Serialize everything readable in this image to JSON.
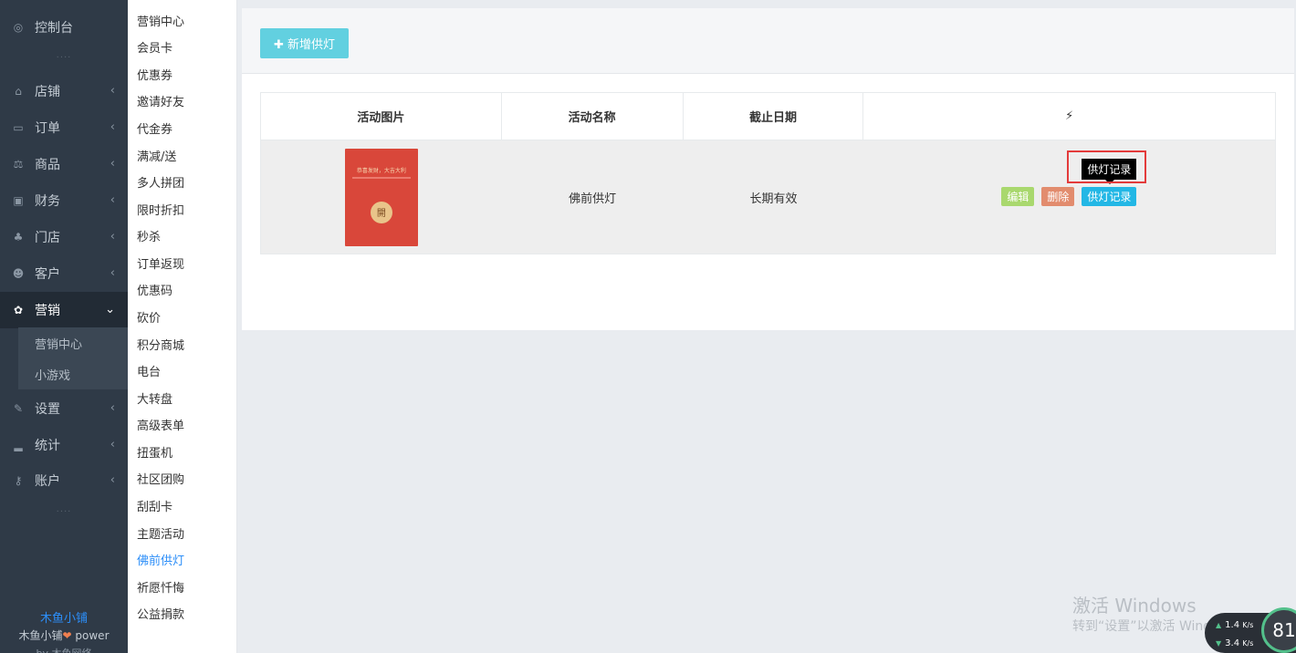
{
  "sidebar": {
    "items": [
      {
        "label": "控制台",
        "icon": "dashboard-icon",
        "chevron": ""
      },
      {
        "label": "店铺",
        "icon": "shop-icon",
        "chevron": "‹"
      },
      {
        "label": "订单",
        "icon": "order-icon",
        "chevron": "‹"
      },
      {
        "label": "商品",
        "icon": "scale-icon",
        "chevron": "‹"
      },
      {
        "label": "财务",
        "icon": "money-icon",
        "chevron": "‹"
      },
      {
        "label": "门店",
        "icon": "store-tree-icon",
        "chevron": "‹"
      },
      {
        "label": "客户",
        "icon": "users-icon",
        "chevron": "‹"
      },
      {
        "label": "营销",
        "icon": "gift-icon",
        "chevron": "⌄"
      },
      {
        "label": "设置",
        "icon": "wrench-icon",
        "chevron": "‹"
      },
      {
        "label": "统计",
        "icon": "signal-icon",
        "chevron": "‹"
      },
      {
        "label": "账户",
        "icon": "key-icon",
        "chevron": "‹"
      }
    ],
    "subitems": [
      "营销中心",
      "小游戏"
    ],
    "dots": "····",
    "brand_name": "木鱼小铺",
    "brand_power": "木鱼小铺",
    "brand_power_suffix": "power",
    "brand_extra": "by 木鱼网络"
  },
  "submenu": {
    "items": [
      "营销中心",
      "会员卡",
      "优惠券",
      "邀请好友",
      "代金券",
      "满减/送",
      "多人拼团",
      "限时折扣",
      "秒杀",
      "订单返现",
      "优惠码",
      "砍价",
      "积分商城",
      "电台",
      "大转盘",
      "高级表单",
      "扭蛋机",
      "社区团购",
      "刮刮卡",
      "主题活动",
      "佛前供灯",
      "祈愿忏悔",
      "公益捐款"
    ],
    "current": "佛前供灯"
  },
  "toolbar": {
    "add_label": "✚ 新增供灯"
  },
  "table": {
    "headers": [
      "活动图片",
      "活动名称",
      "截止日期",
      "⚡"
    ],
    "rows": [
      {
        "thumb_title": "恭喜发财，大吉大利",
        "thumb_coin": "開",
        "name": "佛前供灯",
        "deadline": "长期有效"
      }
    ]
  },
  "actions": {
    "edit": "编辑",
    "delete": "删除",
    "records": "供灯记录",
    "tooltip": "供灯记录"
  },
  "watermark": {
    "line1": "激活 Windows",
    "line2": "转到“设置”以激活 Windows。"
  },
  "net": {
    "up": "1.4",
    "down": "3.4",
    "unit": "K/s",
    "gauge": "81"
  },
  "colors": {
    "accent": "#2c8ef8",
    "sidebar": "#2f3a47",
    "add_button": "#62d0e0",
    "edit": "#a9d86e",
    "delete": "#e28c6e",
    "records": "#23b7e5",
    "highlight": "#e33b3b"
  }
}
